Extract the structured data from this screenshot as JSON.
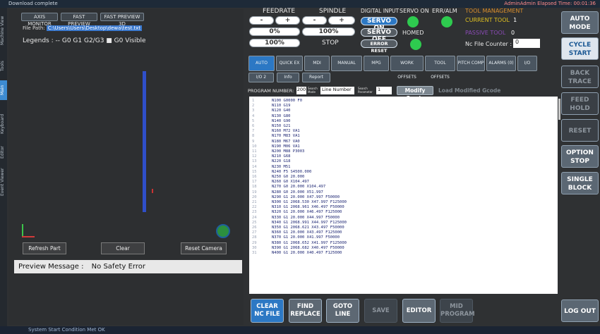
{
  "topbar": {
    "left": "Download complete",
    "right": "AdminAdmin  Elapsed Time: 00:01:36"
  },
  "sidebar": {
    "tabs": [
      "Machine View",
      "Tools",
      "Main",
      "Keyboard",
      "Editor",
      "Event Viewer"
    ]
  },
  "left": {
    "buttons": [
      "AXIS MONITOR",
      "FAST PREVIEW",
      "FAST PREVIEW 3D"
    ],
    "file_path_label": "File Path:",
    "file_path": "C:\\Users\\Users\\Desktop\\dewa\\test.txt",
    "legends": "Legends : -- G0  G1  G2/G3  ■ G0 Visible",
    "controls": [
      "Refresh Part",
      "Clear",
      "Reset Camera"
    ],
    "preview_label": "Preview Message :",
    "preview_msg": "No Safety Error"
  },
  "mid": {
    "feedrate": "FEEDRATE",
    "spindle": "SPINDLE",
    "minus": "-",
    "plus": "+",
    "feed_pct": "0%",
    "spindle_pct": "100%",
    "feed_pct2": "100%",
    "stop": "STOP",
    "digital_input": "DIGITAL INPUT",
    "servo_on_lbl": "SERVO ON",
    "err_alm": "ERR/ALM",
    "tool_mgmt": "TOOL MANAGEMENT",
    "current_tool_lbl": "CURRENT TOOL",
    "current_tool": "1",
    "passive_tool_lbl": "PASSIVE TOOL",
    "passive_tool": "0",
    "nc_counter_lbl": "Nc File Counter :",
    "nc_counter": "0",
    "servo_on_btn": "SERVO ON",
    "servo_off_btn": "SERVO OFF",
    "error_reset": "ERROR RESET",
    "homed": "HOMED",
    "tabs": [
      "AUTO",
      "QUICK EX",
      "MDI",
      "MANUAL",
      "MPG",
      "WORK OFFSETS",
      "TOOL OFFSETS",
      "PITCH COMP",
      "ALARMS (0)",
      "I/O"
    ],
    "tabs2": [
      "I/O 2",
      "Info",
      "Report"
    ],
    "program_number_lbl": "PROGRAM NUMBER:",
    "program_number": "200",
    "search_mode_lbl": "Search Mode",
    "search_mode": "Line Number",
    "search_param_lbl": "Search Parameter",
    "search_param": "1",
    "modify_gcode": "Modify Gcode",
    "load_modified": "Load Modified Gcode",
    "code_lines": [
      [
        "1",
        "N100 G0000 F0"
      ],
      [
        "2",
        "N110 G19"
      ],
      [
        "3",
        "N120 G40"
      ],
      [
        "4",
        "N130 G80"
      ],
      [
        "5",
        "N140 G90"
      ],
      [
        "6",
        "N150 G21"
      ],
      [
        "7",
        "N160 M72 VA1"
      ],
      [
        "8",
        "N170 M83 VA1"
      ],
      [
        "9",
        "N180 M67 VA0"
      ],
      [
        "10",
        "N190 M06 VA1"
      ],
      [
        "11",
        "N200 M88 P3003"
      ],
      [
        "12",
        "N210 G68"
      ],
      [
        "13",
        "N220 G18"
      ],
      [
        "14",
        "N230 M51"
      ],
      [
        "15",
        "N240 F5 S4500.000"
      ],
      [
        "16",
        "N250 G0 20.000"
      ],
      [
        "17",
        "N260 G0 X104.497"
      ],
      [
        "18",
        "N270 G0 20.000 X104.497"
      ],
      [
        "19",
        "N280 G0 20.000 X51.997"
      ],
      [
        "20",
        "N290 G1 20.000 X47.997 F50000"
      ],
      [
        "21",
        "N300 G1 2068.530 X47.997 F125000"
      ],
      [
        "22",
        "N310 G1 2068.961 X46.497 F50000"
      ],
      [
        "23",
        "N320 G1 20.000 X46.497 F125000"
      ],
      [
        "24",
        "N330 G1 20.000 X44.997 F50000"
      ],
      [
        "25",
        "N340 G1 2068.991 X44.997 F125000"
      ],
      [
        "26",
        "N350 G1 2068.621 X43.497 F50000"
      ],
      [
        "27",
        "N360 G1 20.000 X43.497 F125000"
      ],
      [
        "28",
        "N370 G1 20.000 X41.997 F50000"
      ],
      [
        "29",
        "N380 G1 2068.652 X41.997 F125000"
      ],
      [
        "30",
        "N390 G1 2068.682 X40.497 F50000"
      ],
      [
        "31",
        "N400 G1 20.000 X40.497 F125000"
      ]
    ],
    "bottom": [
      "CLEAR NC FILE",
      "FIND REPLACE",
      "GOTO LINE",
      "SAVE",
      "EDITOR",
      "MID PROGRAM"
    ]
  },
  "right": {
    "buttons": [
      "AUTO MODE",
      "CYCLE START",
      "BACK TRACE",
      "FEED HOLD",
      "RESET",
      "OPTION STOP",
      "SINGLE BLOCK"
    ],
    "logout": "LOG OUT"
  },
  "status": "System Start Condition Met OK"
}
